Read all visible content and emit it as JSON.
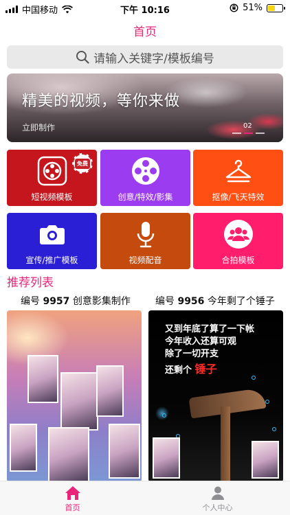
{
  "status_bar": {
    "carrier": "中国移动",
    "time": "下午 10:16",
    "battery": "51%",
    "battery_level": 0.51
  },
  "nav": {
    "title": "首页"
  },
  "search": {
    "placeholder": "请输入关键字/模板编号"
  },
  "banner": {
    "title": "精美的视频，等你来做",
    "subtitle": "立即制作",
    "page_indicator": "02",
    "dot_count": 3,
    "active_dot": 2
  },
  "grid": [
    {
      "label": "短视频模板",
      "icon": "film-reel-icon",
      "color": "#c4161c",
      "badge": "免费"
    },
    {
      "label": "创意/特效/影集",
      "icon": "film-reel-icon",
      "color": "#9b3cf0"
    },
    {
      "label": "抠像/飞天特效",
      "icon": "hanger-icon",
      "color": "#ff4f13"
    },
    {
      "label": "宣传/推广模板",
      "icon": "camera-icon",
      "color": "#2b1fd6"
    },
    {
      "label": "视频配音",
      "icon": "microphone-icon",
      "color": "#c44a0e"
    },
    {
      "label": "合拍模板",
      "icon": "group-icon",
      "color": "#ff1d6c"
    }
  ],
  "recommend": {
    "title": "推荐列表",
    "items": [
      {
        "prefix": "编号",
        "number": "9957",
        "name": "创意影集制作"
      },
      {
        "prefix": "编号",
        "number": "9956",
        "name": "今年剩了个锤子"
      }
    ],
    "right_image_text": {
      "line1": "又到年底了算了一下帐",
      "line2": "今年收入还算可观",
      "line3": "除了一切开支",
      "line4_prefix": "还剩个",
      "line4_highlight": "锤子"
    }
  },
  "tabbar": {
    "home_label": "首页",
    "profile_label": "个人中心"
  },
  "colors": {
    "accent": "#e8247b"
  }
}
